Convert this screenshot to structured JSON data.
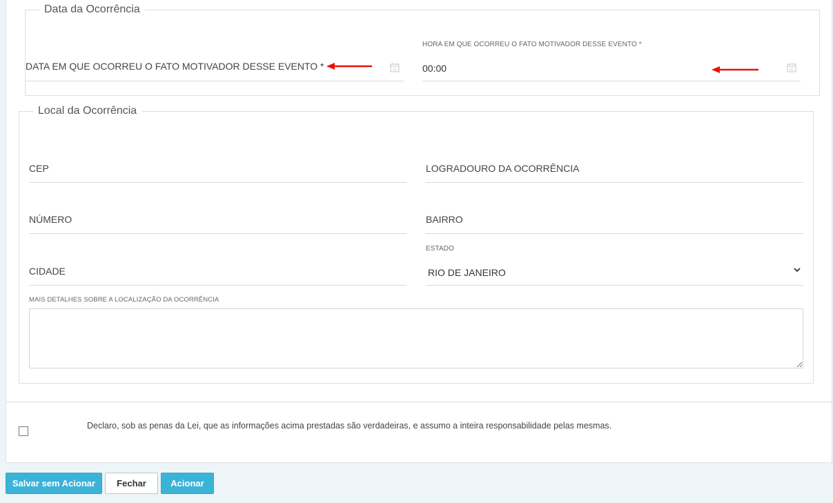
{
  "ocorrencia_data": {
    "legend": "Data da Ocorrência",
    "data_label": "DATA EM QUE OCORREU O FATO MOTIVADOR DESSE EVENTO *",
    "hora_label": "HORA EM QUE OCORREU O FATO MOTIVADOR DESSE EVENTO *",
    "hora_value": "00:00",
    "annotation_arrow_color": "#e8110f"
  },
  "ocorrencia_local": {
    "legend": "Local da Ocorrência",
    "cep_label": "CEP",
    "logradouro_label": "LOGRADOURO DA OCORRÊNCIA",
    "numero_label": "NÚMERO",
    "bairro_label": "BAIRRO",
    "cidade_label": "CIDADE",
    "estado_label": "ESTADO",
    "estado_value": "RIO DE JANEIRO",
    "detalhes_label": "MAIS DETALHES SOBRE A LOCALIZAÇÃO DA OCORRÊNCIA"
  },
  "declaracao": {
    "text": "Declaro, sob as penas da Lei, que as informações acima prestadas são verdadeiras, e assumo a inteira responsabilidade pelas mesmas.",
    "checked": false
  },
  "actions": {
    "salvar_label": "Salvar sem Acionar",
    "fechar_label": "Fechar",
    "acionar_label": "Acionar",
    "primary_color": "#3bb3d6"
  }
}
